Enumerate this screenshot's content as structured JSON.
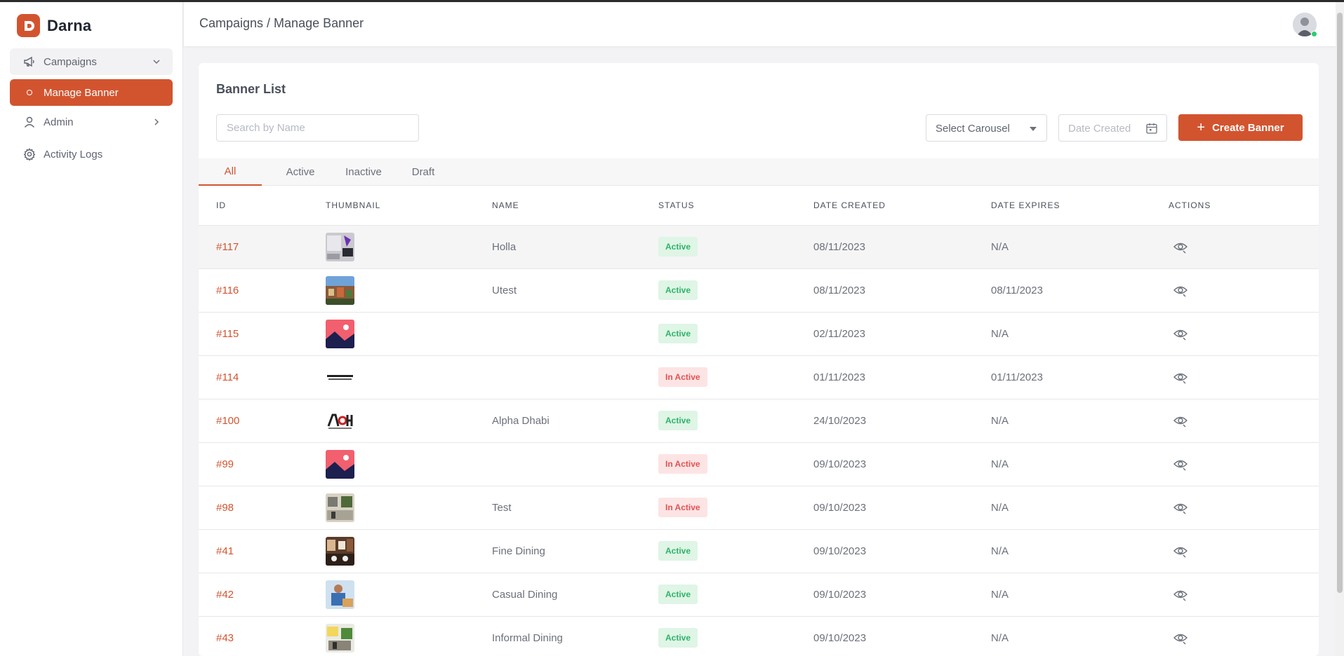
{
  "app": {
    "name": "Darna",
    "brand_color": "#d2542f"
  },
  "sidebar": {
    "items": [
      {
        "label": "Campaigns",
        "icon": "megaphone-icon"
      },
      {
        "label": "Manage Banner"
      },
      {
        "label": "Admin",
        "icon": "user-icon"
      },
      {
        "label": "Activity Logs",
        "icon": "gear-icon"
      }
    ]
  },
  "header": {
    "breadcrumb": "Campaigns / Manage Banner"
  },
  "main": {
    "title": "Banner List",
    "search_placeholder": "Search by Name",
    "carousel_select": "Select Carousel",
    "date_placeholder": "Date Created",
    "create_label": "Create Banner",
    "tabs": [
      "All",
      "Active",
      "Inactive",
      "Draft"
    ],
    "columns": [
      "ID",
      "THUMBNAIL",
      "NAME",
      "STATUS",
      "DATE CREATED",
      "DATE EXPIRES",
      "ACTIONS"
    ],
    "rows": [
      {
        "id": "#117",
        "thumb": "purple-promo",
        "name": "Holla",
        "status": "Active",
        "created": "08/11/2023",
        "expires": "N/A"
      },
      {
        "id": "#116",
        "thumb": "city-photo",
        "name": "Utest",
        "status": "Active",
        "created": "08/11/2023",
        "expires": "08/11/2023"
      },
      {
        "id": "#115",
        "thumb": "placeholder-image",
        "name": "",
        "status": "Active",
        "created": "02/11/2023",
        "expires": "N/A"
      },
      {
        "id": "#114",
        "thumb": "text-logo",
        "name": "",
        "status": "In Active",
        "created": "01/11/2023",
        "expires": "01/11/2023"
      },
      {
        "id": "#100",
        "thumb": "aoh-logo",
        "name": "Alpha Dhabi",
        "status": "Active",
        "created": "24/10/2023",
        "expires": "N/A"
      },
      {
        "id": "#99",
        "thumb": "placeholder-image",
        "name": "",
        "status": "In Active",
        "created": "09/10/2023",
        "expires": "N/A"
      },
      {
        "id": "#98",
        "thumb": "restaurant-photo",
        "name": "Test",
        "status": "In Active",
        "created": "09/10/2023",
        "expires": "N/A"
      },
      {
        "id": "#41",
        "thumb": "dining-photo",
        "name": "Fine Dining",
        "status": "Active",
        "created": "09/10/2023",
        "expires": "N/A"
      },
      {
        "id": "#42",
        "thumb": "chef-photo",
        "name": "Casual Dining",
        "status": "Active",
        "created": "09/10/2023",
        "expires": "N/A"
      },
      {
        "id": "#43",
        "thumb": "kitchen-photo",
        "name": "Informal Dining",
        "status": "Active",
        "created": "09/10/2023",
        "expires": "N/A"
      }
    ]
  }
}
